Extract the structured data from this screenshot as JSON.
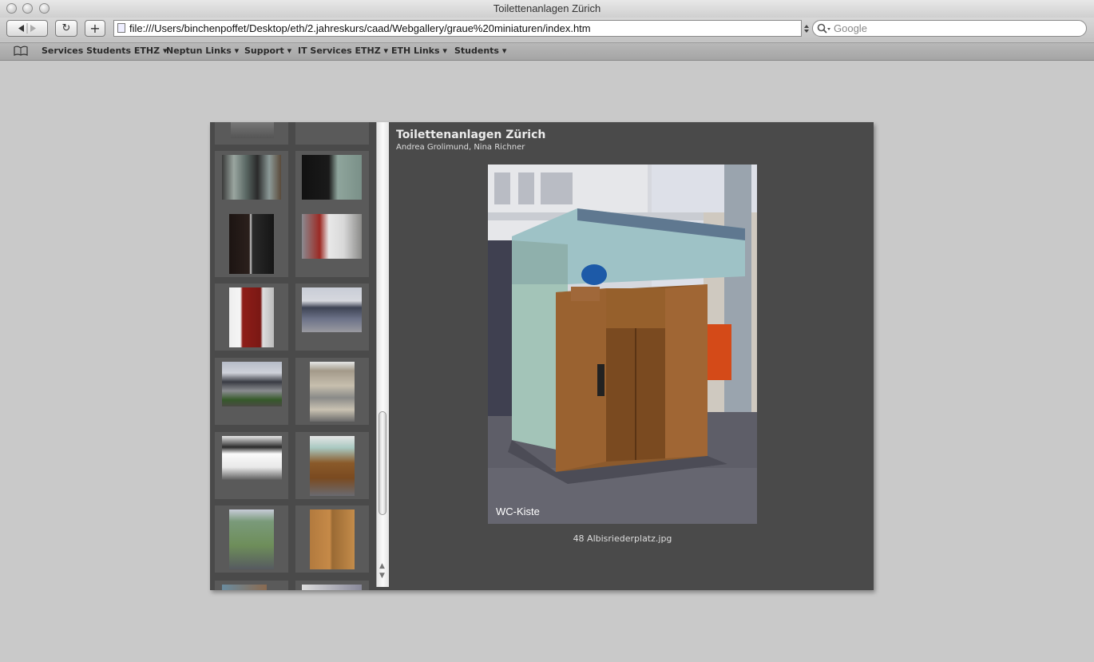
{
  "window": {
    "title": "Toilettenanlagen Zürich"
  },
  "toolbar": {
    "url": "file:///Users/binchenpoffet/Desktop/eth/2.jahreskurs/caad/Webgallery/graue%20miniaturen/index.htm",
    "search_placeholder": "Google",
    "reload_glyph": "↻",
    "add_glyph": "+"
  },
  "bookmarks": [
    {
      "label": "Services Students ETHZ ▾"
    },
    {
      "label": "Neptun Links ▾"
    },
    {
      "label": "Support ▾"
    },
    {
      "label": "IT Services ETHZ ▾"
    },
    {
      "label": "ETH Links ▾"
    },
    {
      "label": "Students ▾"
    }
  ],
  "gallery": {
    "title": "Toilettenanlagen Zürich",
    "authors": "Andrea Grolimund, Nina Richner",
    "image_caption": "WC-Kiste",
    "file_name": "48 Albisriederplatz.jpg"
  },
  "icons": [
    "back-icon",
    "forward-icon",
    "reload-icon",
    "add-bookmark-icon",
    "file-icon",
    "search-icon",
    "bookmarks-book-icon"
  ],
  "colors": {
    "gallery_bg": "#4a4a4a",
    "page_bg": "#c9c9c9",
    "thumb_cell": "#5a5a5a"
  }
}
